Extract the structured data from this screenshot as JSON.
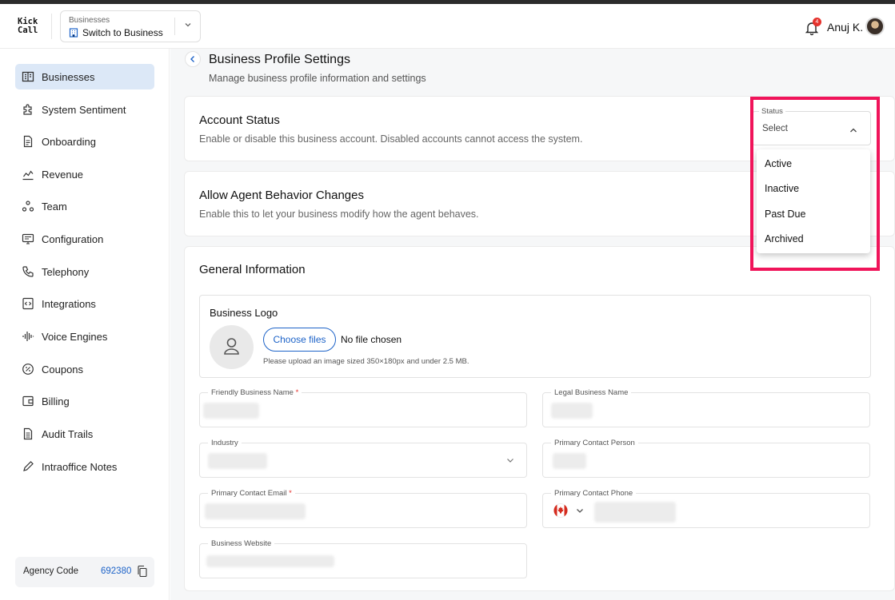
{
  "header": {
    "logo_line1": "Kick",
    "logo_line2": "Call",
    "switcher_caption": "Businesses",
    "switcher_value": "Switch to Business",
    "notification_count": "4",
    "user_name": "Anuj K."
  },
  "sidebar": {
    "items": [
      {
        "label": "Businesses",
        "icon": "building-icon",
        "active": true
      },
      {
        "label": "System Sentiment",
        "icon": "puzzle-icon"
      },
      {
        "label": "Onboarding",
        "icon": "document-icon"
      },
      {
        "label": "Revenue",
        "icon": "trend-icon"
      },
      {
        "label": "Team",
        "icon": "team-icon"
      },
      {
        "label": "Configuration",
        "icon": "config-icon"
      },
      {
        "label": "Telephony",
        "icon": "phone-icon"
      },
      {
        "label": "Integrations",
        "icon": "code-icon"
      },
      {
        "label": "Voice Engines",
        "icon": "waveform-icon"
      },
      {
        "label": "Coupons",
        "icon": "coupon-icon"
      },
      {
        "label": "Billing",
        "icon": "wallet-icon"
      },
      {
        "label": "Audit Trails",
        "icon": "list-icon"
      },
      {
        "label": "Intraoffice Notes",
        "icon": "pencil-icon"
      }
    ],
    "agency_label": "Agency Code",
    "agency_code": "692380"
  },
  "page": {
    "title": "Business Profile Settings",
    "subtitle": "Manage business profile information and settings"
  },
  "account_status": {
    "title": "Account Status",
    "desc": "Enable or disable this business account. Disabled accounts cannot access the system.",
    "status_label": "Status",
    "status_value": "Select",
    "options": [
      "Active",
      "Inactive",
      "Past Due",
      "Archived"
    ]
  },
  "agent_behavior": {
    "title": "Allow Agent Behavior Changes",
    "desc": "Enable this to let your business modify how the agent behaves."
  },
  "general": {
    "title": "General Information",
    "logo_title": "Business Logo",
    "choose_files": "Choose files",
    "no_file": "No file chosen",
    "upload_hint": "Please upload an image sized 350×180px and under 2.5 MB.",
    "fields": {
      "friendly_name": "Friendly Business Name",
      "legal_name": "Legal Business Name",
      "industry": "Industry",
      "contact_person": "Primary Contact Person",
      "contact_email": "Primary Contact Email",
      "contact_phone": "Primary Contact Phone",
      "website": "Business Website"
    }
  },
  "colors": {
    "accent": "#1d63c8",
    "highlight": "#f0145a",
    "active_nav": "#dce8f7"
  }
}
